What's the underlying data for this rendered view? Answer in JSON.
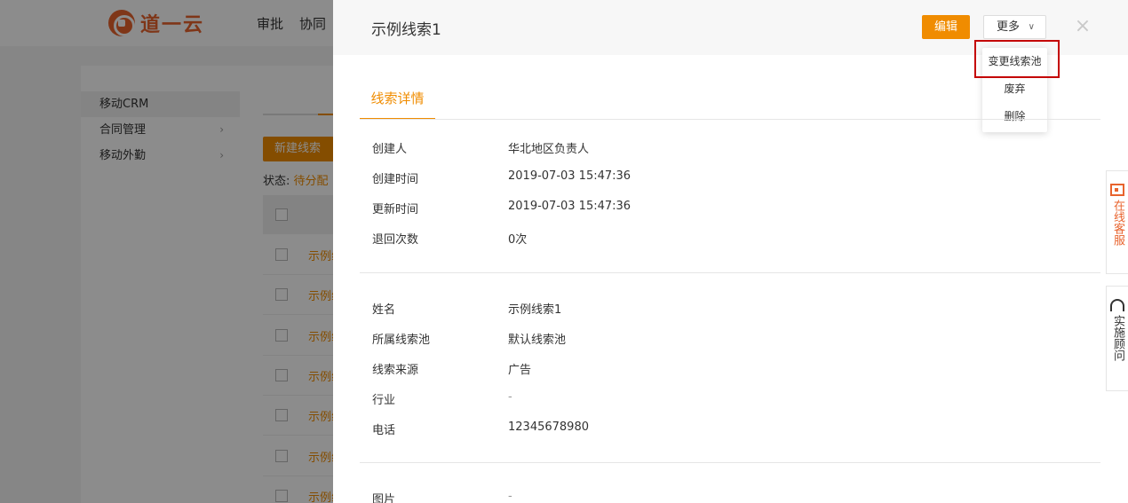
{
  "app": {
    "logo_text": "道一云",
    "nav": [
      "审批",
      "协同"
    ]
  },
  "sidebar": {
    "items": [
      {
        "label": "移动CRM"
      },
      {
        "label": "合同管理"
      },
      {
        "label": "移动外勤"
      }
    ]
  },
  "list": {
    "new_button": "新建线索",
    "status_label": "状态:",
    "status_value": "待分配",
    "row_link_text": "示例线",
    "rows": 7
  },
  "drawer": {
    "title": "示例线索1",
    "edit_label": "编辑",
    "more_label": "更多",
    "close_icon": "×",
    "menu": [
      "变更线索池",
      "废弃",
      "删除"
    ],
    "tab_label": "线索详情",
    "section1": [
      {
        "label": "创建人",
        "value": "华北地区负责人"
      },
      {
        "label": "创建时间",
        "value": "2019-07-03 15:47:36"
      },
      {
        "label": "更新时间",
        "value": "2019-07-03 15:47:36"
      },
      {
        "label": "退回次数",
        "value": "0次"
      }
    ],
    "section2": [
      {
        "label": "姓名",
        "value": "示例线索1"
      },
      {
        "label": "所属线索池",
        "value": "默认线索池"
      },
      {
        "label": "线索来源",
        "value": "广告"
      },
      {
        "label": "行业",
        "value": "-"
      },
      {
        "label": "电话",
        "value": "12345678980"
      }
    ],
    "section3": [
      {
        "label": "图片",
        "value": "-"
      }
    ]
  },
  "side_widgets": {
    "online_service": "在线客服",
    "consultant": "实施顾问"
  },
  "colors": {
    "accent": "#f08c00",
    "brand": "#e8632d",
    "highlight": "#c40000"
  }
}
